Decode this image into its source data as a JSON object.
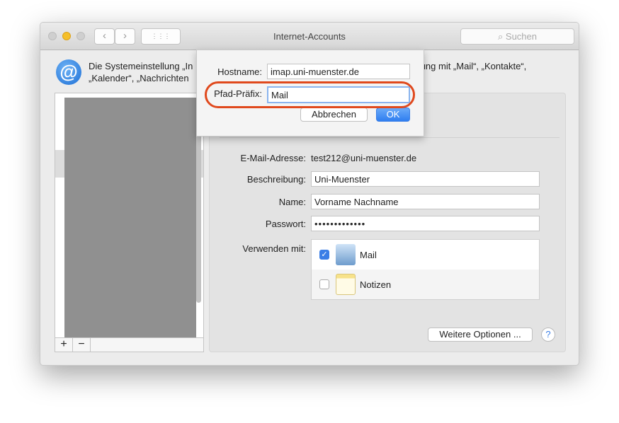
{
  "window": {
    "title": "Internet-Accounts",
    "search_placeholder": "Suchen",
    "back": "‹",
    "forward": "›",
    "grid": "⋮⋮⋮"
  },
  "intro": {
    "line1_left": "Die Systemeinstellung „In",
    "line1_right": "endung mit „Mail“, „Kontakte“,",
    "line2": "„Kalender“, „Nachrichten"
  },
  "sidebar": {
    "add": "+",
    "remove": "−"
  },
  "form": {
    "email_label": "E-Mail-Adresse:",
    "email_value": "test212@uni-muenster.de",
    "description_label": "Beschreibung:",
    "description_value": "Uni-Muenster",
    "name_label": "Name:",
    "name_value": "Vorname Nachname",
    "password_label": "Passwort:",
    "password_value": "•••••••••••••",
    "use_with_label": "Verwenden mit:",
    "apps": [
      {
        "label": "Mail",
        "checked": true
      },
      {
        "label": "Notizen",
        "checked": false
      }
    ],
    "more_options": "Weitere Optionen ...",
    "help": "?"
  },
  "dialog": {
    "hostname_label": "Hostname:",
    "hostname_value": "imap.uni-muenster.de",
    "prefix_label": "Pfad-Präfix:",
    "prefix_value": "Mail",
    "cancel": "Abbrechen",
    "ok": "OK"
  },
  "colors": {
    "highlight": "#e0491d",
    "accent": "#3a7ee6"
  }
}
